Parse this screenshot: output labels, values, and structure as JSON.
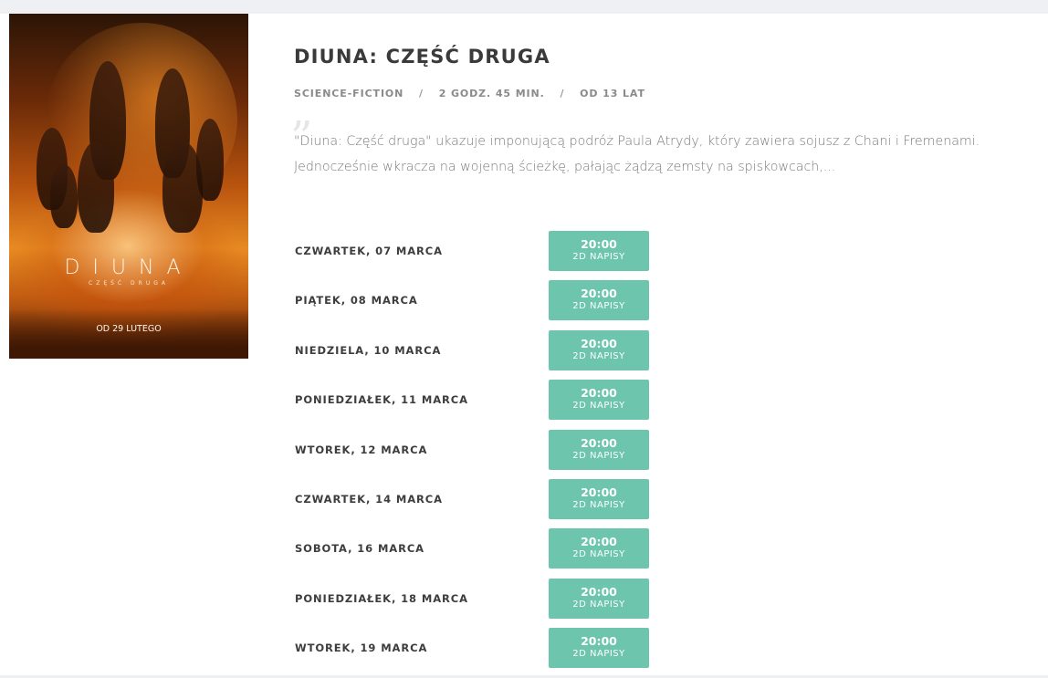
{
  "movie": {
    "title": "DIUNA: CZĘŚĆ DRUGA",
    "genre": "SCIENCE-FICTION",
    "duration": "2 GODZ. 45 MIN.",
    "age": "OD 13 LAT",
    "separator": "/",
    "description": "\"Diuna: Część druga\" ukazuje imponującą podróż Paula Atrydy, który zawiera sojusz z Chani i Fremenami. Jednocześnie wkracza na wojenną ścieżkę, pałając żądzą zemsty na spiskowcach,..."
  },
  "poster": {
    "title": "DIUNA",
    "subtitle": "CZĘŚĆ DRUGA",
    "release": "OD 29 LUTEGO"
  },
  "showings": [
    {
      "day": "CZWARTEK, 07 MARCA",
      "time": "20:00",
      "format": "2D NAPISY"
    },
    {
      "day": "PIĄTEK, 08 MARCA",
      "time": "20:00",
      "format": "2D NAPISY"
    },
    {
      "day": "NIEDZIELA, 10 MARCA",
      "time": "20:00",
      "format": "2D NAPISY"
    },
    {
      "day": "PONIEDZIAŁEK, 11 MARCA",
      "time": "20:00",
      "format": "2D NAPISY"
    },
    {
      "day": "WTOREK, 12 MARCA",
      "time": "20:00",
      "format": "2D NAPISY"
    },
    {
      "day": "CZWARTEK, 14 MARCA",
      "time": "20:00",
      "format": "2D NAPISY"
    },
    {
      "day": "SOBOTA, 16 MARCA",
      "time": "20:00",
      "format": "2D NAPISY"
    },
    {
      "day": "PONIEDZIAŁEK, 18 MARCA",
      "time": "20:00",
      "format": "2D NAPISY"
    },
    {
      "day": "WTOREK, 19 MARCA",
      "time": "20:00",
      "format": "2D NAPISY"
    }
  ],
  "colors": {
    "accent": "#6dc5ad",
    "page_bg": "#eef0f4",
    "card_bg": "#ffffff"
  }
}
